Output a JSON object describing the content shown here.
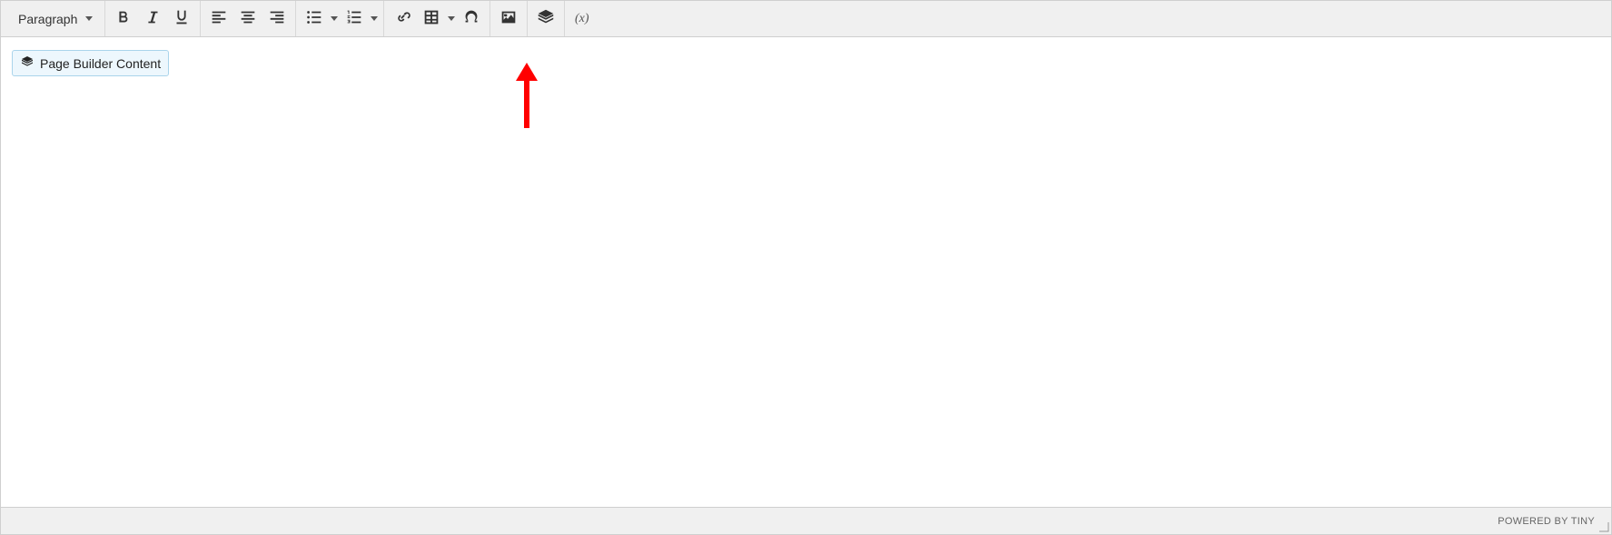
{
  "toolbar": {
    "format_label": "Paragraph",
    "icons": {
      "bold": "bold-icon",
      "italic": "italic-icon",
      "underline": "underline-icon",
      "align_left": "align-left-icon",
      "align_center": "align-center-icon",
      "align_right": "align-right-icon",
      "bullet_list": "bullet-list-icon",
      "number_list": "number-list-icon",
      "link": "link-icon",
      "table": "table-icon",
      "special_char": "omega-icon",
      "image": "image-icon",
      "widget": "stack-icon",
      "variable": "variable-icon"
    },
    "variable_label": "(x)"
  },
  "content": {
    "widget_chip_label": "Page Builder Content"
  },
  "statusbar": {
    "branding": "POWERED BY TINY"
  },
  "annotation": {
    "arrow_color": "#ff0000"
  }
}
